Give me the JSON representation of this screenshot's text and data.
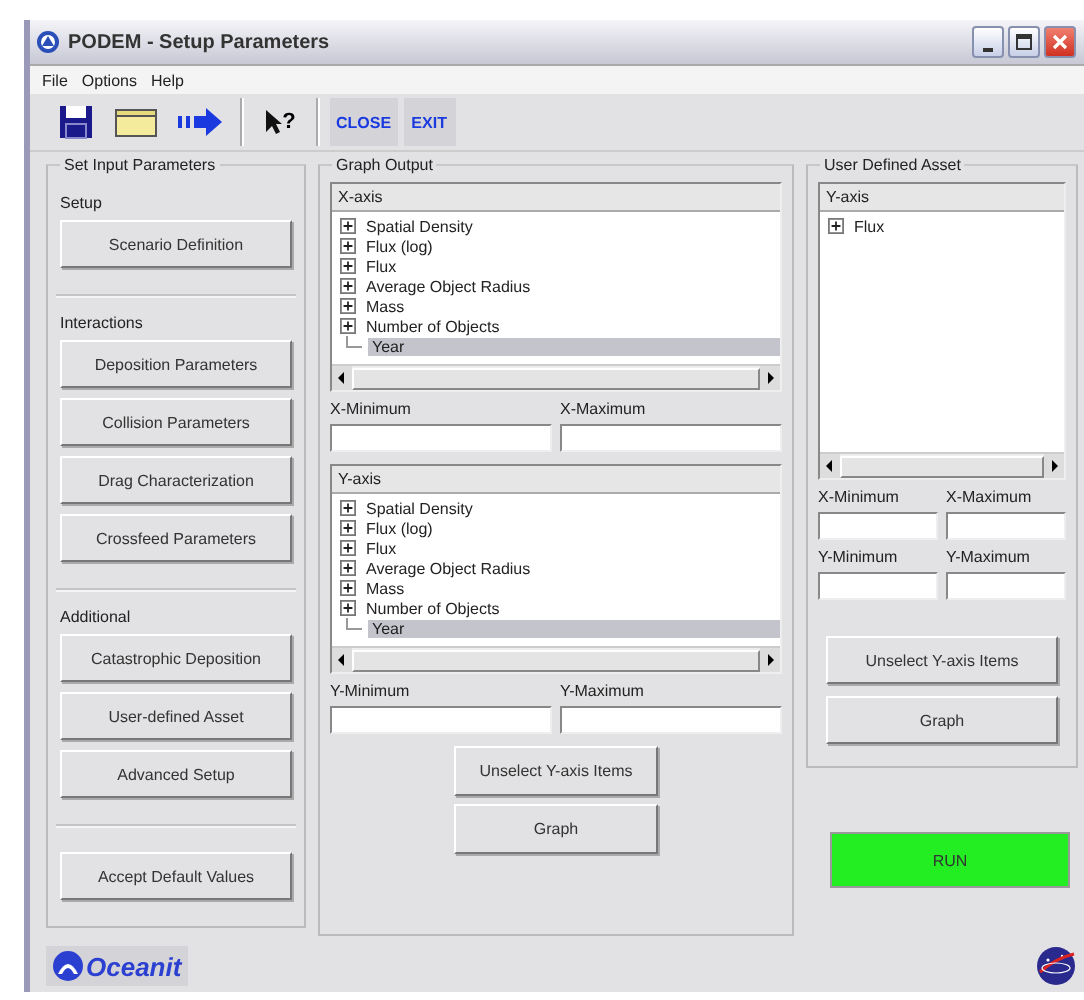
{
  "window": {
    "title": "PODEM - Setup Parameters"
  },
  "menu": [
    "File",
    "Options",
    "Help"
  ],
  "toolbar": [
    {
      "kind": "save"
    },
    {
      "kind": "open"
    },
    {
      "kind": "forward"
    },
    {
      "kind": "help",
      "text": "?"
    },
    {
      "kind": "text",
      "label": "CLOSE"
    },
    {
      "kind": "text",
      "label": "EXIT"
    }
  ],
  "input_parameters": {
    "title": "Set Input Parameters",
    "sections": [
      {
        "heading": "Setup",
        "buttons": [
          "Scenario Definition"
        ]
      },
      {
        "heading": "Interactions",
        "buttons": [
          "Deposition Parameters",
          "Collision Parameters",
          "Drag Characterization",
          "Crossfeed Parameters"
        ]
      },
      {
        "heading": "Additional",
        "buttons": [
          "Catastrophic Deposition",
          "User-defined Asset",
          "Advanced Setup"
        ]
      }
    ],
    "accept_button": "Accept Default Values"
  },
  "graph_output": {
    "title": "Graph Output",
    "x_axis": {
      "header": "X-axis",
      "items": [
        {
          "label": "Spatial Density",
          "kind": "node",
          "selected": false
        },
        {
          "label": "Flux (log)",
          "kind": "node",
          "selected": false
        },
        {
          "label": "Flux",
          "kind": "node",
          "selected": false
        },
        {
          "label": "Average Object Radius",
          "kind": "node",
          "selected": false
        },
        {
          "label": "Mass",
          "kind": "node",
          "selected": false
        },
        {
          "label": "Number of Objects",
          "kind": "node",
          "selected": false
        },
        {
          "label": "Year",
          "kind": "leaf",
          "selected": true
        }
      ]
    },
    "x_fields": [
      "X-Minimum",
      "X-Maximum"
    ],
    "y_axis": {
      "header": "Y-axis",
      "items": [
        {
          "label": "Spatial Density",
          "kind": "node",
          "selected": false
        },
        {
          "label": "Flux (log)",
          "kind": "node",
          "selected": false
        },
        {
          "label": "Flux",
          "kind": "node",
          "selected": false
        },
        {
          "label": "Average Object Radius",
          "kind": "node",
          "selected": false
        },
        {
          "label": "Mass",
          "kind": "node",
          "selected": false
        },
        {
          "label": "Number of Objects",
          "kind": "node",
          "selected": false
        },
        {
          "label": "Year",
          "kind": "leaf",
          "selected": true
        }
      ]
    },
    "y_fields": [
      "Y-Minimum",
      "Y-Maximum"
    ],
    "buttons": [
      "Unselect Y-axis Items",
      "Graph"
    ]
  },
  "user_defined_asset": {
    "title": "User Defined Asset",
    "tree": {
      "header": "Y-axis",
      "items": [
        {
          "label": "Flux",
          "kind": "node",
          "selected": false
        }
      ]
    },
    "x_fields": [
      "X-Minimum",
      "X-Maximum"
    ],
    "y_fields": [
      "Y-Minimum",
      "Y-Maximum"
    ],
    "buttons": [
      "Unselect Y-axis Items",
      "Graph"
    ]
  },
  "run_button": "RUN",
  "footer": {
    "logo": "Oceanit"
  }
}
